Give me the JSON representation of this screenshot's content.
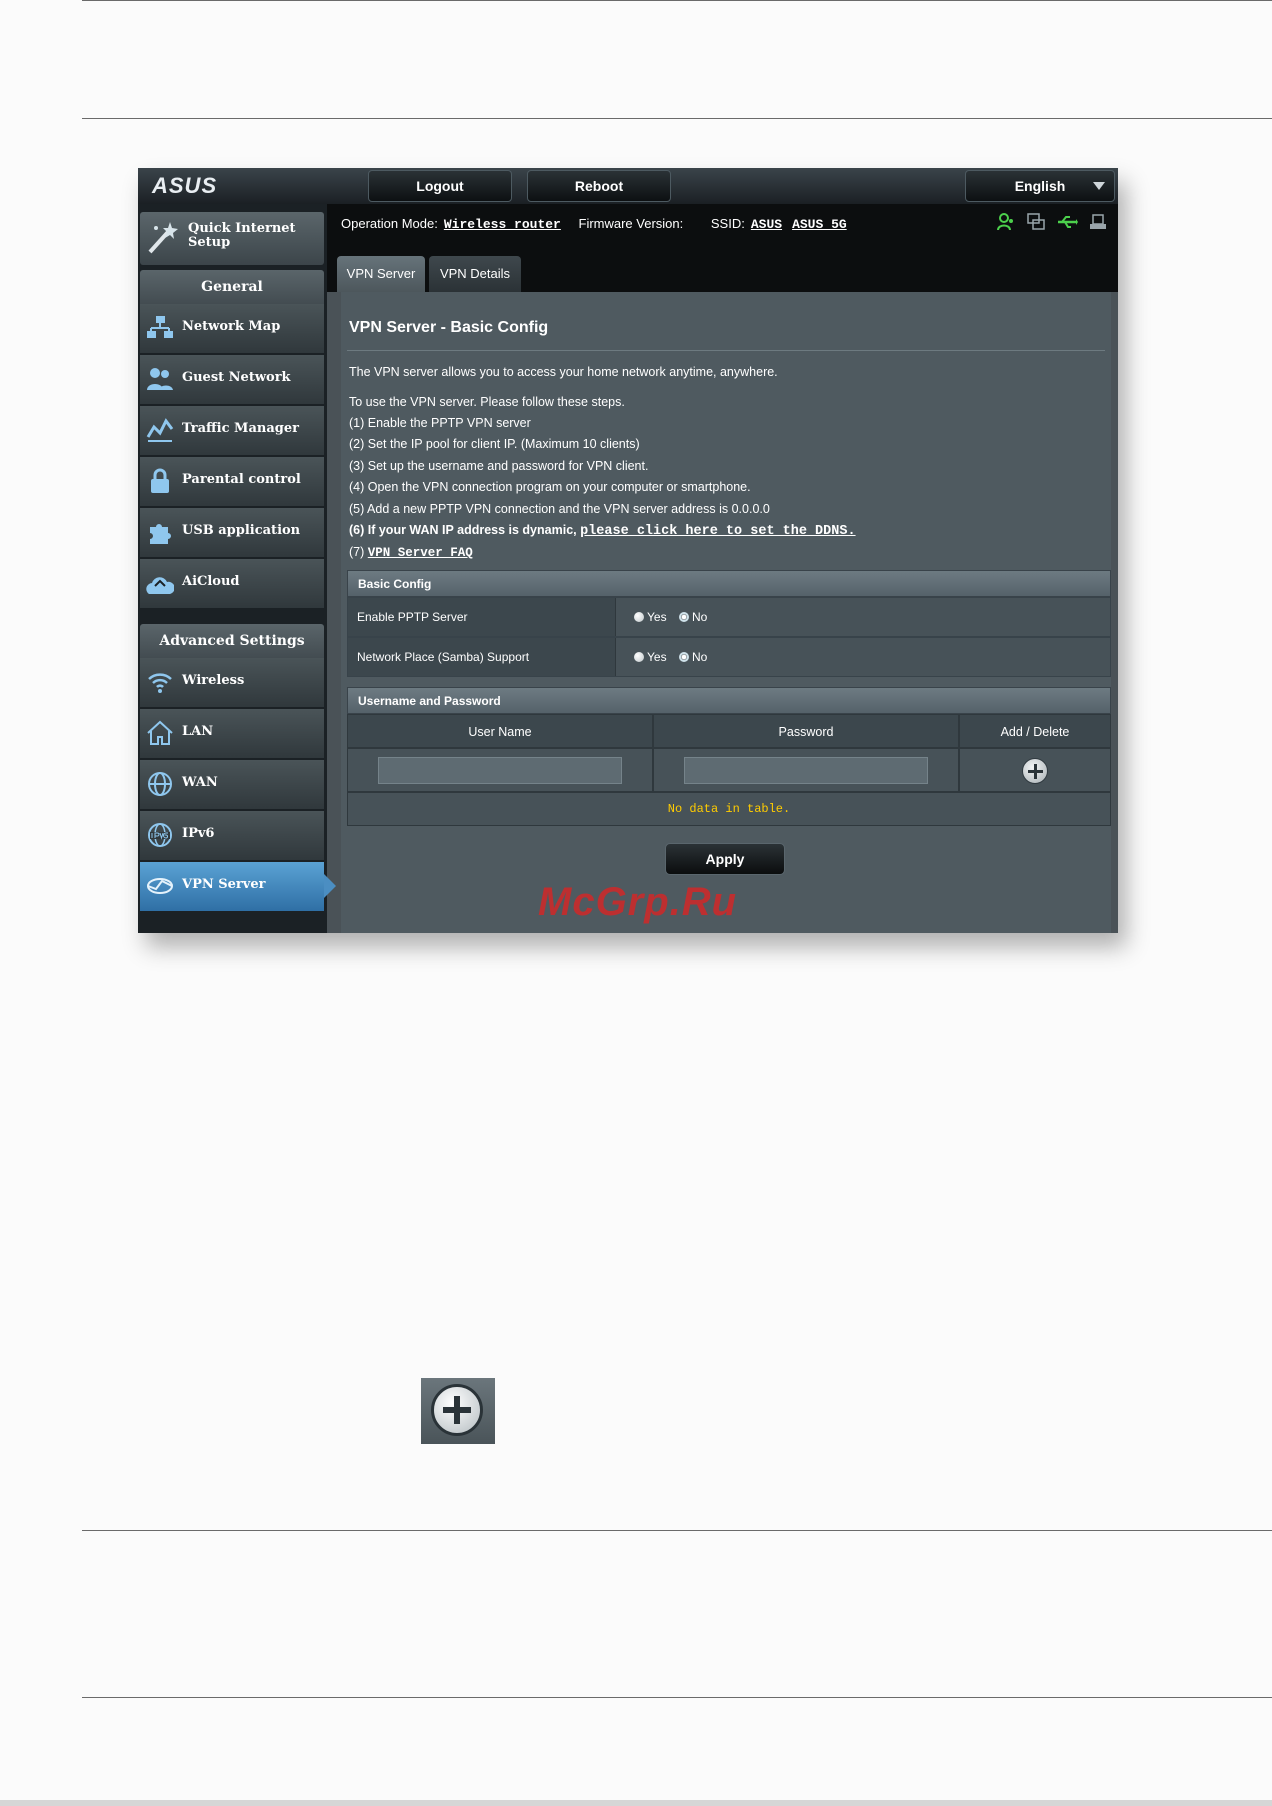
{
  "topbar": {
    "logo": "ASUS",
    "logout_label": "Logout",
    "reboot_label": "Reboot",
    "language": "English"
  },
  "header": {
    "op_mode_label": "Operation Mode:",
    "op_mode_value": "Wireless router",
    "firmware_label": "Firmware Version:",
    "ssid_label": "SSID:",
    "ssid_1": "ASUS",
    "ssid_2": "ASUS_5G"
  },
  "tabs": [
    {
      "label": "VPN Server"
    },
    {
      "label": "VPN Details"
    }
  ],
  "sidebar": {
    "quick_setup": "Quick Internet Setup",
    "general_head": "General",
    "general_items": [
      {
        "label": "Network Map"
      },
      {
        "label": "Guest Network"
      },
      {
        "label": "Traffic Manager"
      },
      {
        "label": "Parental control"
      },
      {
        "label": "USB application"
      },
      {
        "label": "AiCloud"
      }
    ],
    "advanced_head": "Advanced Settings",
    "advanced_items": [
      {
        "label": "Wireless"
      },
      {
        "label": "LAN"
      },
      {
        "label": "WAN"
      },
      {
        "label": "IPv6"
      },
      {
        "label": "VPN Server"
      }
    ]
  },
  "content": {
    "title": "VPN Server - Basic Config",
    "intro": "The VPN server allows you to access your home network anytime, anywhere.",
    "steps_head": "To use the VPN server. Please follow these steps.",
    "step1": "(1) Enable the PPTP VPN server",
    "step2": "(2) Set the IP pool for client IP. (Maximum 10 clients)",
    "step3": "(3) Set up the username and password for VPN client.",
    "step4": "(4) Open the VPN connection program on your computer or smartphone.",
    "step5": "(5) Add a new PPTP VPN connection and the VPN server address is 0.0.0.0",
    "step6_prefix": "(6) If your WAN IP address is dynamic,",
    "step6_link": "please click here to set the DDNS.",
    "step7_prefix": "(7)",
    "step7_link": "VPN Server FAQ",
    "basic_config_head": "Basic Config",
    "pptp_label": "Enable PPTP Server",
    "samba_label": "Network Place (Samba) Support",
    "yes": "Yes",
    "no": "No",
    "userpass_head": "Username and Password",
    "col_user": "User Name",
    "col_pass": "Password",
    "col_add": "Add / Delete",
    "no_data": "No data in table.",
    "apply": "Apply"
  },
  "watermark": "McGrp.Ru",
  "colors": {
    "accent": "#4b8ec2",
    "nodata": "#ffcc00",
    "status_green": "#4cd04c"
  }
}
